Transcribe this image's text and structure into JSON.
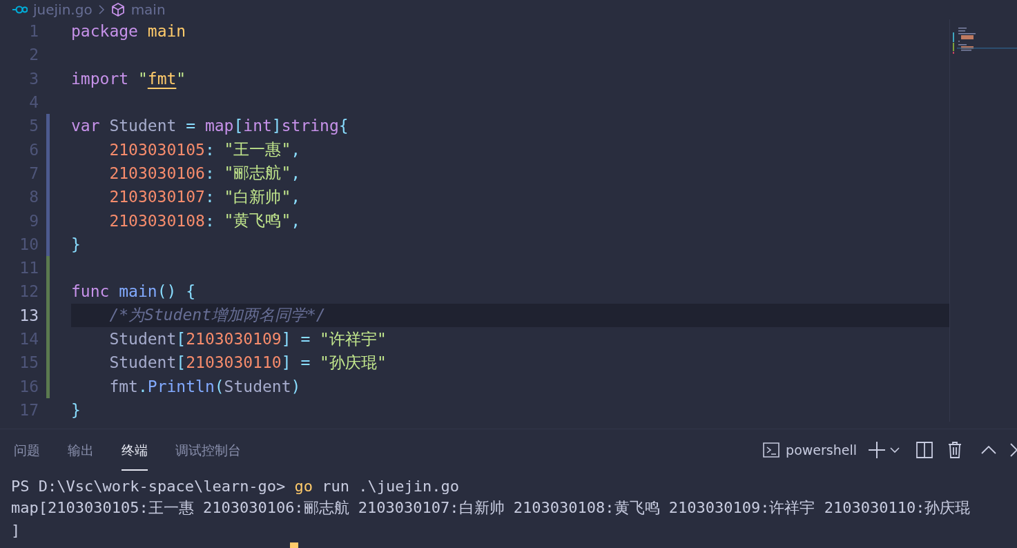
{
  "breadcrumb": {
    "file": "juejin.go",
    "symbol": "main"
  },
  "code_lines": [
    {
      "number": "1",
      "modified": false,
      "added": false,
      "current": false,
      "tokens": [
        {
          "kind": "keyword",
          "text": "package"
        },
        {
          "kind": "package",
          "text": " main"
        }
      ]
    },
    {
      "number": "2",
      "modified": false,
      "added": false,
      "current": false
    },
    {
      "number": "3",
      "modified": false,
      "added": false,
      "current": false,
      "tokens": [
        {
          "kind": "keyword",
          "text": "import"
        },
        {
          "kind": "string",
          "text": " \""
        },
        {
          "kind": "import-path",
          "text": "fmt"
        },
        {
          "kind": "string",
          "text": "\""
        }
      ]
    },
    {
      "number": "4",
      "modified": false,
      "added": false,
      "current": false
    },
    {
      "number": "5",
      "modified": true,
      "added": false,
      "current": false,
      "tokens": [
        {
          "kind": "keyword",
          "text": "var"
        },
        {
          "kind": "plain",
          "text": " Student"
        },
        {
          "kind": "punct",
          "text": " ="
        },
        {
          "kind": "keyword",
          "text": " map"
        },
        {
          "kind": "punct",
          "text": "["
        },
        {
          "kind": "keyword",
          "text": "int"
        },
        {
          "kind": "punct",
          "text": "]"
        },
        {
          "kind": "keyword",
          "text": "string"
        },
        {
          "kind": "punct",
          "text": "{"
        }
      ]
    },
    {
      "number": "6",
      "modified": true,
      "added": false,
      "current": false,
      "tokens": [
        {
          "kind": "number",
          "text": "    2103030105"
        },
        {
          "kind": "punct",
          "text": ":"
        },
        {
          "kind": "string",
          "text": " \"王一惠\""
        },
        {
          "kind": "punct",
          "text": ","
        }
      ]
    },
    {
      "number": "7",
      "modified": true,
      "added": false,
      "current": false,
      "tokens": [
        {
          "kind": "number",
          "text": "    2103030106"
        },
        {
          "kind": "punct",
          "text": ":"
        },
        {
          "kind": "string",
          "text": " \"郦志航\""
        },
        {
          "kind": "punct",
          "text": ","
        }
      ]
    },
    {
      "number": "8",
      "modified": true,
      "added": false,
      "current": false,
      "tokens": [
        {
          "kind": "number",
          "text": "    2103030107"
        },
        {
          "kind": "punct",
          "text": ":"
        },
        {
          "kind": "string",
          "text": " \"白新帅\""
        },
        {
          "kind": "punct",
          "text": ","
        }
      ]
    },
    {
      "number": "9",
      "modified": true,
      "added": false,
      "current": false,
      "tokens": [
        {
          "kind": "number",
          "text": "    2103030108"
        },
        {
          "kind": "punct",
          "text": ":"
        },
        {
          "kind": "string",
          "text": " \"黄飞鸣\""
        },
        {
          "kind": "punct",
          "text": ","
        }
      ]
    },
    {
      "number": "10",
      "modified": true,
      "added": false,
      "current": false,
      "tokens": [
        {
          "kind": "punct",
          "text": "}"
        }
      ]
    },
    {
      "number": "11",
      "modified": false,
      "added": true,
      "current": false
    },
    {
      "number": "12",
      "modified": false,
      "added": true,
      "current": false,
      "tokens": [
        {
          "kind": "keyword",
          "text": "func"
        },
        {
          "kind": "function",
          "text": " main"
        },
        {
          "kind": "punct",
          "text": "()"
        },
        {
          "kind": "punct",
          "text": " {"
        }
      ]
    },
    {
      "number": "13",
      "modified": false,
      "added": true,
      "current": true,
      "tokens": [
        {
          "kind": "comment",
          "text": "    /*为Student增加两名同学*/"
        }
      ]
    },
    {
      "number": "14",
      "modified": false,
      "added": true,
      "current": false,
      "tokens": [
        {
          "kind": "plain",
          "text": "    Student"
        },
        {
          "kind": "punct",
          "text": "["
        },
        {
          "kind": "number",
          "text": "2103030109"
        },
        {
          "kind": "punct",
          "text": "]"
        },
        {
          "kind": "punct",
          "text": " ="
        },
        {
          "kind": "string",
          "text": " \"许祥宇\""
        }
      ]
    },
    {
      "number": "15",
      "modified": false,
      "added": true,
      "current": false,
      "tokens": [
        {
          "kind": "plain",
          "text": "    Student"
        },
        {
          "kind": "punct",
          "text": "["
        },
        {
          "kind": "number",
          "text": "2103030110"
        },
        {
          "kind": "punct",
          "text": "]"
        },
        {
          "kind": "punct",
          "text": " ="
        },
        {
          "kind": "string",
          "text": " \"孙庆琨\""
        }
      ]
    },
    {
      "number": "16",
      "modified": false,
      "added": true,
      "current": false,
      "tokens": [
        {
          "kind": "plain",
          "text": "    fmt"
        },
        {
          "kind": "punct",
          "text": "."
        },
        {
          "kind": "function",
          "text": "Println"
        },
        {
          "kind": "punct",
          "text": "("
        },
        {
          "kind": "plain",
          "text": "Student"
        },
        {
          "kind": "punct",
          "text": ")"
        }
      ]
    },
    {
      "number": "17",
      "modified": false,
      "added": false,
      "current": false,
      "tokens": [
        {
          "kind": "punct",
          "text": "}"
        }
      ]
    }
  ],
  "panel": {
    "tabs": [
      {
        "label": "问题",
        "selected": false
      },
      {
        "label": "输出",
        "selected": false
      },
      {
        "label": "终端",
        "selected": true
      },
      {
        "label": "调试控制台",
        "selected": false
      }
    ],
    "terminal_name": "powershell",
    "terminal_lines": [
      [
        {
          "kind": "plain",
          "text": "PS D:\\Vsc\\work-space\\learn-go>"
        },
        {
          "kind": "command",
          "text": " go"
        },
        {
          "kind": "plain",
          "text": " run .\\juejin.go"
        }
      ],
      [
        {
          "kind": "plain",
          "text": "map[2103030105:王一惠 2103030106:郦志航 2103030107:白新帅 2103030108:黄飞鸣 2103030109:许祥宇 2103030110:孙庆琨"
        }
      ],
      [
        {
          "kind": "plain",
          "text": "]"
        }
      ]
    ]
  }
}
